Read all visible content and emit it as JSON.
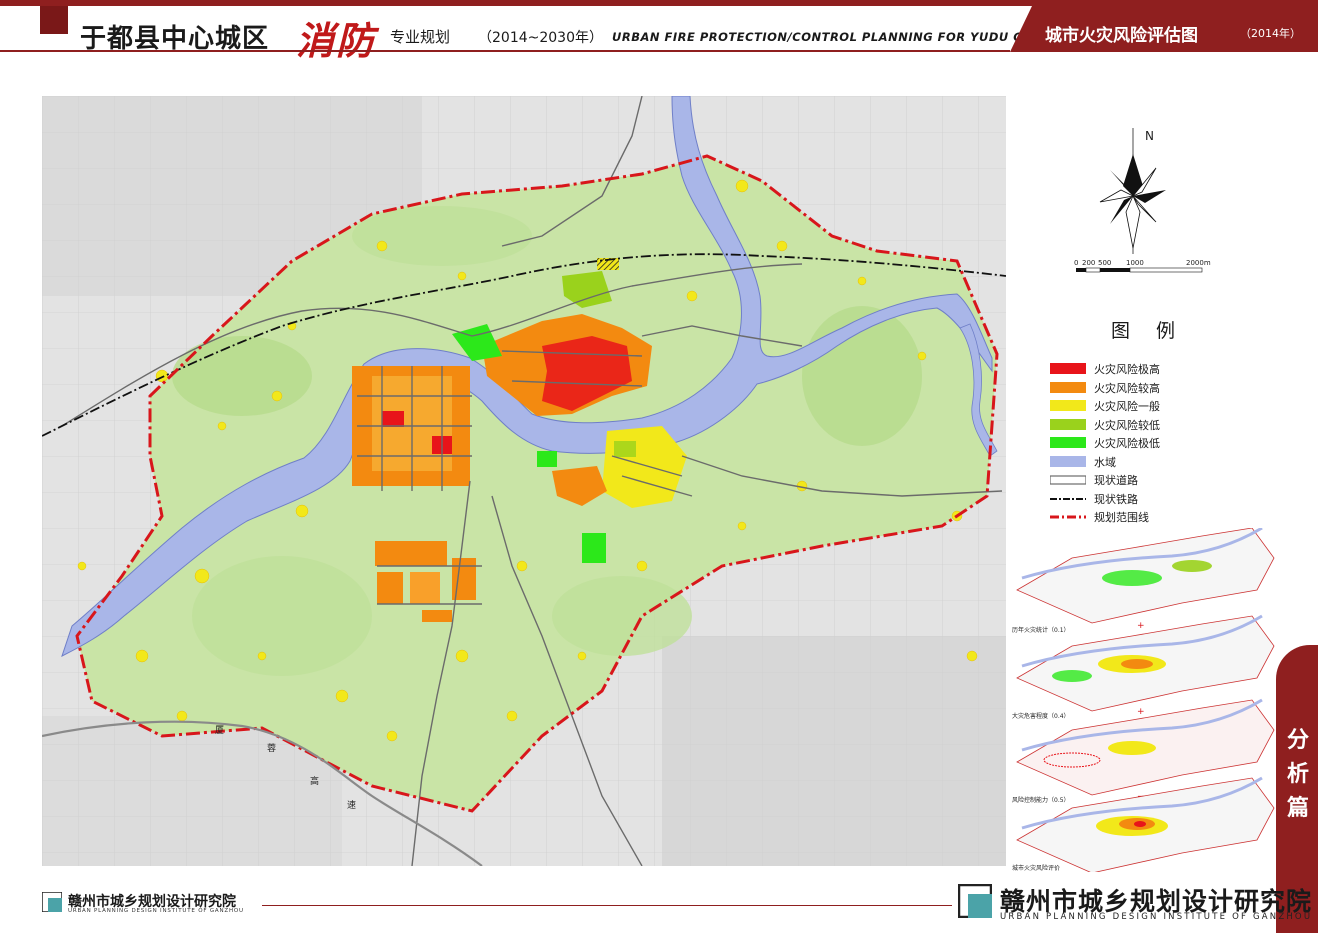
{
  "header": {
    "title_main": "于都县中心城区",
    "title_big": "消防",
    "title_sub": "专业规划",
    "title_years": "（2014~2030年）",
    "title_en": "URBAN FIRE PROTECTION/CONTROL PLANNING FOR YUDU CITY"
  },
  "tab": {
    "title": "城市火灾风险评估图",
    "year": "（2014年）"
  },
  "compass": {
    "north_label": "N"
  },
  "scale": {
    "labels": [
      "0",
      "200",
      "500",
      "1000",
      "2000m"
    ]
  },
  "legend": {
    "title": "图 例",
    "items": [
      {
        "label": "火灾风险极高",
        "color": "#e8141a",
        "kind": "fill"
      },
      {
        "label": "火灾风险较高",
        "color": "#f38a10",
        "kind": "fill"
      },
      {
        "label": "火灾风险一般",
        "color": "#f2e81a",
        "kind": "fill"
      },
      {
        "label": "火灾风险较低",
        "color": "#9ad21c",
        "kind": "fill"
      },
      {
        "label": "火灾风险极低",
        "color": "#2ce81a",
        "kind": "fill"
      },
      {
        "label": "水域",
        "color": "#a9b6e8",
        "kind": "fill"
      },
      {
        "label": "现状道路",
        "color": "#6b6b6b",
        "kind": "road"
      },
      {
        "label": "现状铁路",
        "color": "#111111",
        "kind": "rail"
      },
      {
        "label": "规划范围线",
        "color": "#d8161b",
        "kind": "boundary"
      }
    ]
  },
  "layers": {
    "labels": [
      "历年火灾统计（0.1）",
      "大灾危害程度（0.4）",
      "风险控制能力（0.5）",
      "城市火灾风险评价"
    ],
    "operators": [
      "+",
      "+",
      "="
    ]
  },
  "map_labels": {
    "expressway": [
      "厦",
      "蓉",
      "高",
      "速"
    ]
  },
  "side_tab": {
    "chars": [
      "分",
      "析",
      "篇"
    ]
  },
  "footer": {
    "left_cn": "赣州市城乡规划设计研究院",
    "left_en": "URBAN PLANNING DESIGN INSTITUTE OF GANZHOU",
    "right_cn": "赣州市城乡规划设计研究院",
    "right_en": "URBAN PLANNING DESIGN INSTITUTE OF GANZHOU"
  },
  "colors": {
    "brand": "#8f1f1f",
    "boundary": "#d8161b",
    "water": "#a9b6e8",
    "vegetation": "#c9e4a6"
  }
}
